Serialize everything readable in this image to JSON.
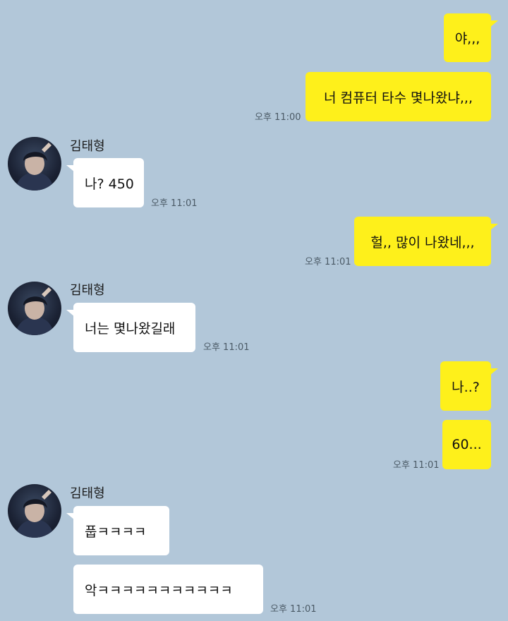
{
  "partner": {
    "name": "김태형"
  },
  "messages": [
    {
      "text": "야,,,",
      "time": ""
    },
    {
      "text": "너 컴퓨터 타수 몇나왔냐,,,",
      "time": "오후 11:00"
    },
    {
      "text": "나? 450",
      "time": "오후 11:01"
    },
    {
      "text": "헐,, 많이 나왔네,,,",
      "time": "오후 11:01"
    },
    {
      "text": "너는 몇나왔길래",
      "time": "오후 11:01"
    },
    {
      "text": "나..?",
      "time": ""
    },
    {
      "text": "60...",
      "time": "오후 11:01"
    },
    {
      "text": "풉ㅋㅋㅋㅋ",
      "time": ""
    },
    {
      "text": "악ㅋㅋㅋㅋㅋㅋㅋㅋㅋㅋㅋ",
      "time": "오후 11:01"
    }
  ],
  "colors": {
    "background": "#b2c7d9",
    "my_bubble": "#fef01b",
    "partner_bubble": "#ffffff",
    "timestamp": "#4b5a66"
  }
}
